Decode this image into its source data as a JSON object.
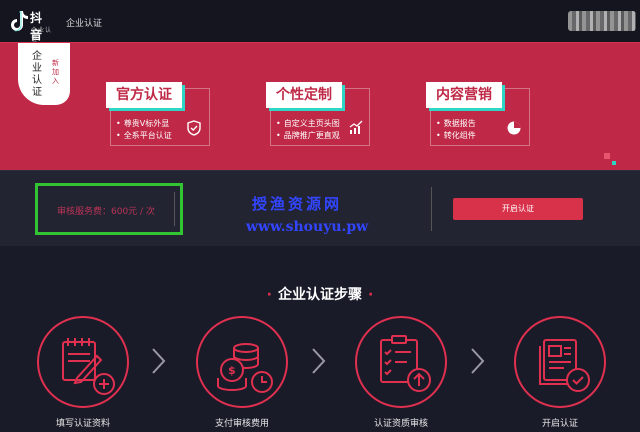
{
  "app": {
    "logo_title": "抖音",
    "logo_sub": "企业认证",
    "nav_item": "企业认证"
  },
  "banner": {
    "tag_text": "企业认证",
    "tag_new": "新加入",
    "cards": [
      {
        "title": "官方认证",
        "items": [
          "尊贵V标外显",
          "全系平台认证"
        ],
        "icon": "shield-check-icon"
      },
      {
        "title": "个性定制",
        "items": [
          "自定义主页头图",
          "品牌推广更直观"
        ],
        "icon": "growth-chart-icon"
      },
      {
        "title": "内容营销",
        "items": [
          "数据报告",
          "转化组件"
        ],
        "icon": "pie-chart-icon"
      }
    ]
  },
  "fee": {
    "label": "审核服务费：600元 / 次",
    "button": "开启认证"
  },
  "watermark": {
    "cn": "授渔资源网",
    "url": "www.shouyu.pw"
  },
  "steps": {
    "title": "企业认证步骤",
    "items": [
      {
        "label": "填写认证资料",
        "icon": "form-edit-icon"
      },
      {
        "label": "支付审核费用",
        "icon": "coins-clock-icon"
      },
      {
        "label": "认证资质审核",
        "icon": "checklist-upload-icon"
      },
      {
        "label": "开启认证",
        "icon": "document-check-icon"
      }
    ]
  },
  "colors": {
    "brand_red": "#bf2846",
    "accent_red": "#e03050",
    "teal": "#2ed6c6",
    "dark_bg": "#1a1b28"
  }
}
